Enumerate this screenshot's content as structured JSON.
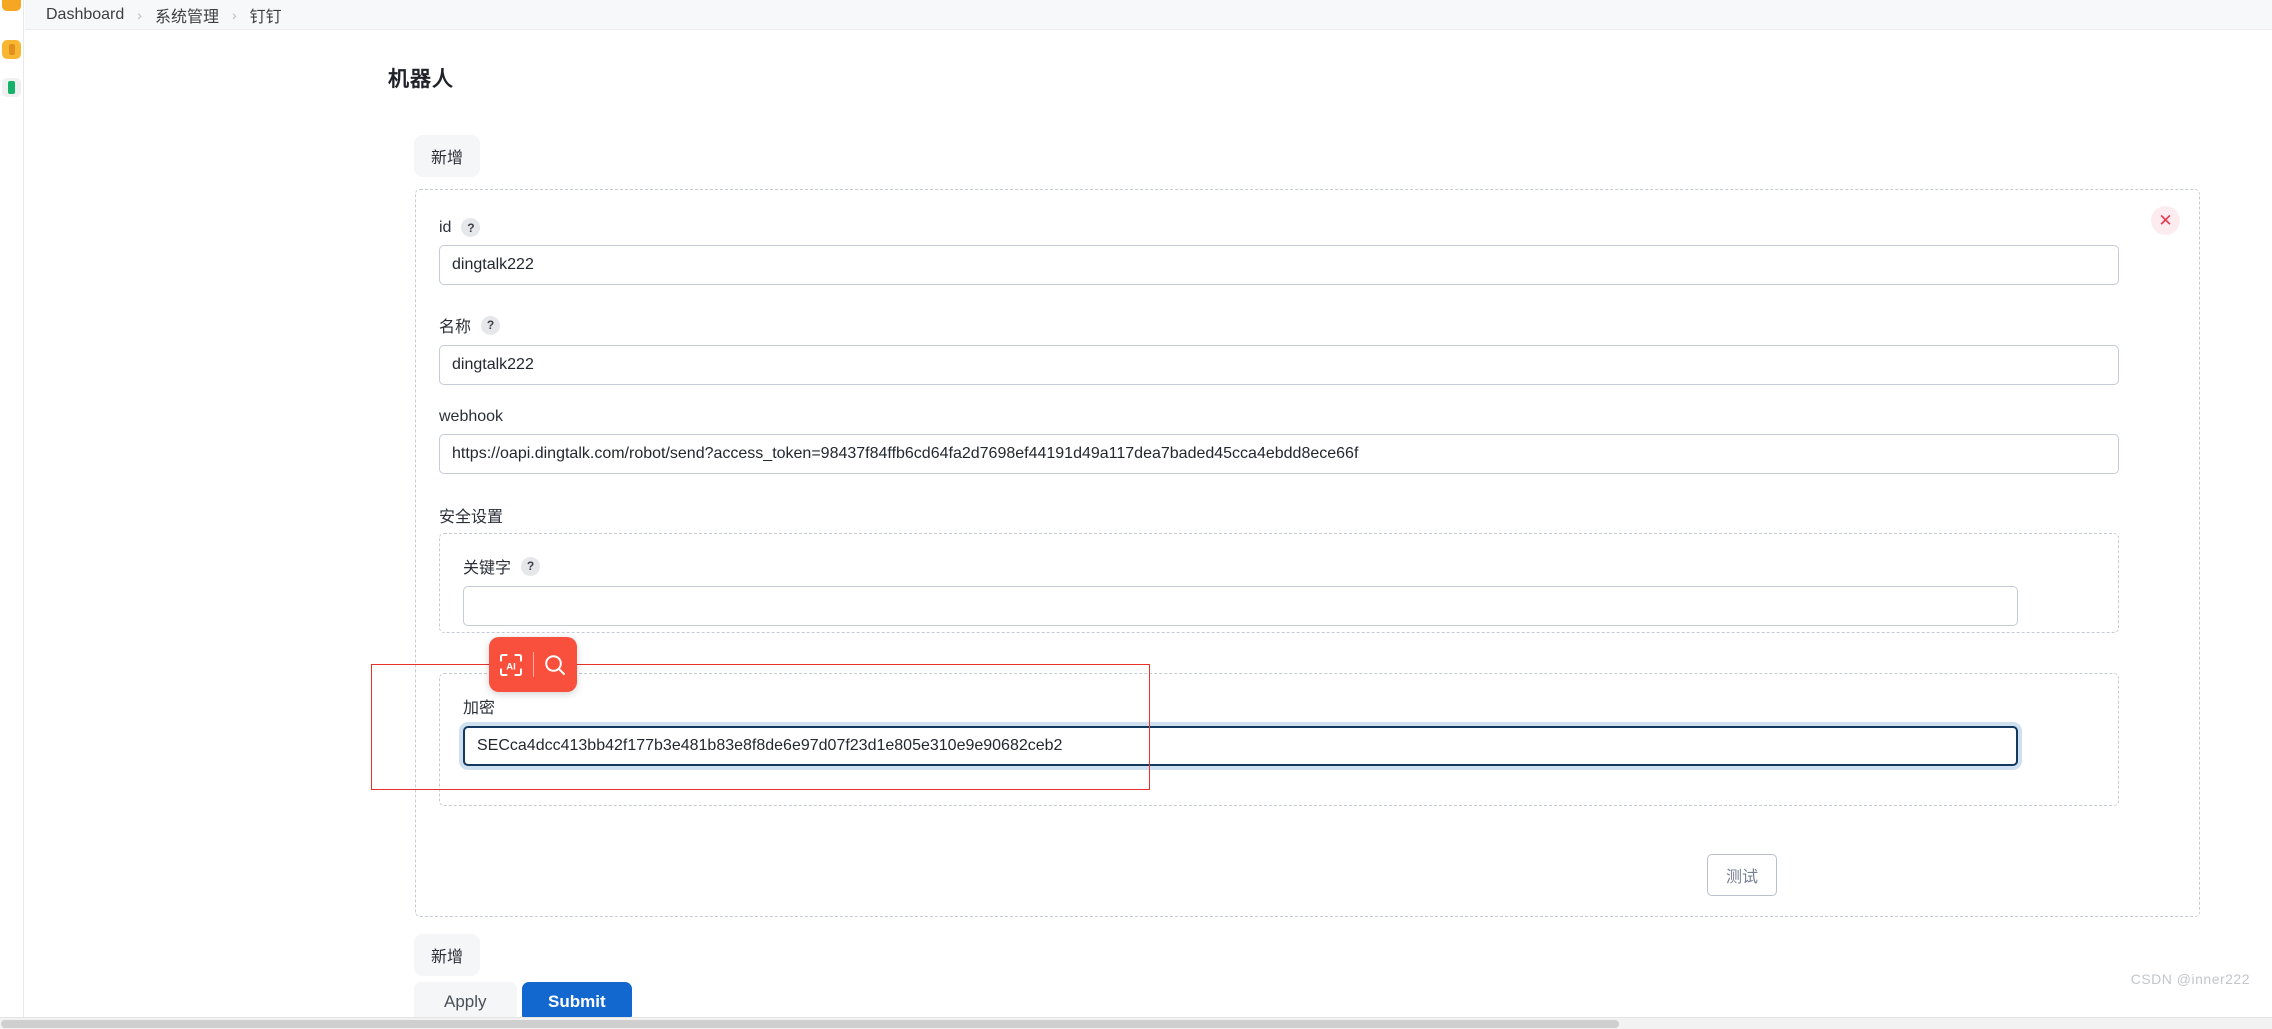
{
  "breadcrumb": {
    "items": [
      "Dashboard",
      "系统管理",
      "钉钉"
    ],
    "separator": "›"
  },
  "page": {
    "title": "机器人",
    "add_tab_top_label": "新增",
    "add_tab_bottom_label": "新增"
  },
  "record": {
    "close_icon": "✕",
    "help_icon": "?"
  },
  "fields": {
    "id": {
      "label": "id",
      "value": "dingtalk222",
      "placeholder": "",
      "has_help": true
    },
    "name": {
      "label": "名称",
      "value": "dingtalk222",
      "placeholder": "",
      "has_help": true
    },
    "webhook": {
      "label": "webhook",
      "value": "https://oapi.dingtalk.com/robot/send?access_token=98437f84ffb6cd64fa2d7698ef44191d49a117dea7baded45cca4ebdd8ece66f",
      "placeholder": "",
      "has_help": false
    },
    "security_settings": {
      "label": "安全设置"
    },
    "keyword": {
      "label": "关键字",
      "value": "",
      "placeholder": "",
      "has_help": true
    },
    "encrypt": {
      "label": "加密",
      "value": "SECca4dcc413bb42f177b3e481b83e8f8de6e97d07f23d1e805e310e9e90682ceb2",
      "placeholder": "",
      "has_help": false,
      "focused": true
    }
  },
  "buttons": {
    "test_label": "测试",
    "apply_label": "Apply",
    "submit_label": "Submit"
  },
  "ai_toolbar": {
    "scan_icon": "ai-scan-icon",
    "search_icon": "search-icon",
    "color": "#f8503c"
  },
  "annotation": {
    "color": "#e8312b"
  },
  "watermark": {
    "text": "CSDN @inner222"
  },
  "colors": {
    "primary": "#1268cf",
    "danger": "#e8384f",
    "accent_red": "#f8503c",
    "border_dashed": "#c5cbd4",
    "focus_border": "#14395e"
  }
}
